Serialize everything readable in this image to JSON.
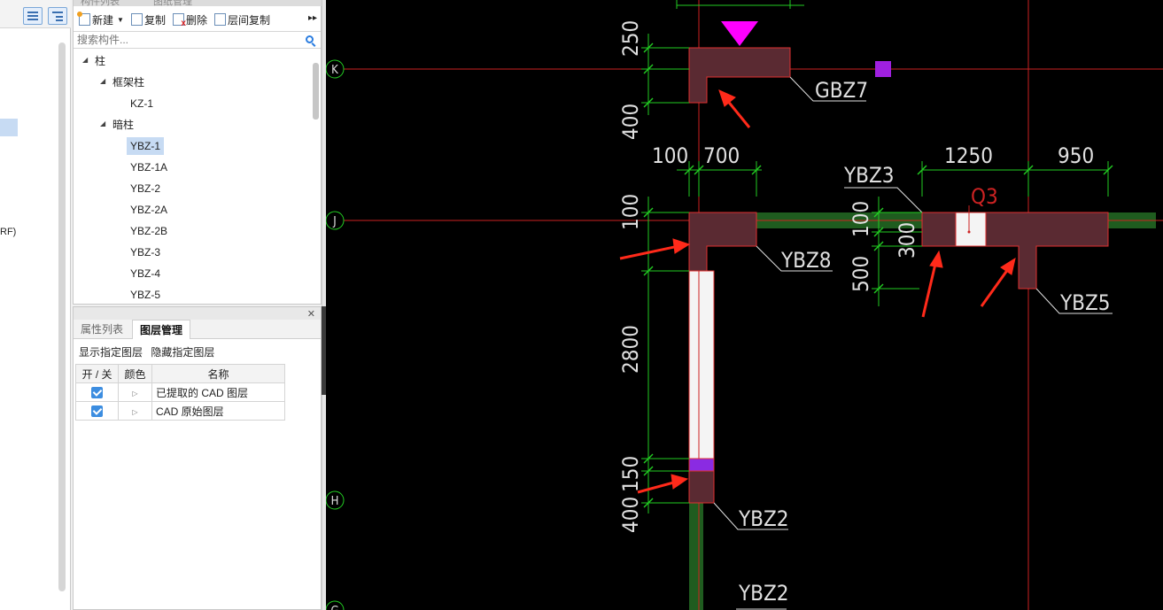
{
  "left_panel": {
    "fragment_text": "RF)"
  },
  "component_panel": {
    "tabs": [
      "构件列表",
      "图纸管理"
    ],
    "toolbar": {
      "new_label": "新建",
      "copy_label": "复制",
      "delete_label": "删除",
      "floor_copy_label": "层间复制"
    },
    "search": {
      "placeholder": "搜索构件..."
    },
    "tree": {
      "root": "柱",
      "group1": "框架柱",
      "group1_items": [
        "KZ-1"
      ],
      "group2": "暗柱",
      "group2_items": [
        "YBZ-1",
        "YBZ-1A",
        "YBZ-2",
        "YBZ-2A",
        "YBZ-2B",
        "YBZ-3",
        "YBZ-4",
        "YBZ-5"
      ],
      "selected": "YBZ-1"
    }
  },
  "layer_panel": {
    "tabs": [
      "属性列表",
      "图层管理"
    ],
    "active_tab": "图层管理",
    "actions": [
      "显示指定图层",
      "隐藏指定图层"
    ],
    "columns": [
      "开 / 关",
      "颜色",
      "名称"
    ],
    "rows": [
      {
        "on": true,
        "name": "已提取的 CAD 图层"
      },
      {
        "on": true,
        "name": "CAD 原始图层"
      }
    ]
  },
  "cad": {
    "axis_labels": {
      "k": "K",
      "j": "J",
      "h": "H",
      "g": "G"
    },
    "dimensions": {
      "d250": "250",
      "d400a": "400",
      "d100a": "100",
      "d700": "700",
      "d100b": "100",
      "d1250": "1250",
      "d950": "950",
      "d100c": "100",
      "d300": "300",
      "d500": "500",
      "d2800": "2800",
      "d150": "150",
      "d400b": "400"
    },
    "labels": {
      "gbz7": "GBZ7",
      "ybz3": "YBZ3",
      "q3": "Q3",
      "ybz8": "YBZ8",
      "ybz5": "YBZ5",
      "ybz2a": "YBZ2",
      "ybz2b": "YBZ2"
    },
    "colors": {
      "background": "#000000",
      "axis": "#cc2222",
      "dim": "#22cc22",
      "column_fill": "#5a2a32",
      "column_edge": "#e03030",
      "wall_green": "#1f5c1f",
      "arrow": "#ff2a1a",
      "marker": "#ff00ff",
      "hatch": "#8a2be2",
      "label": "#e0e0e0"
    }
  }
}
